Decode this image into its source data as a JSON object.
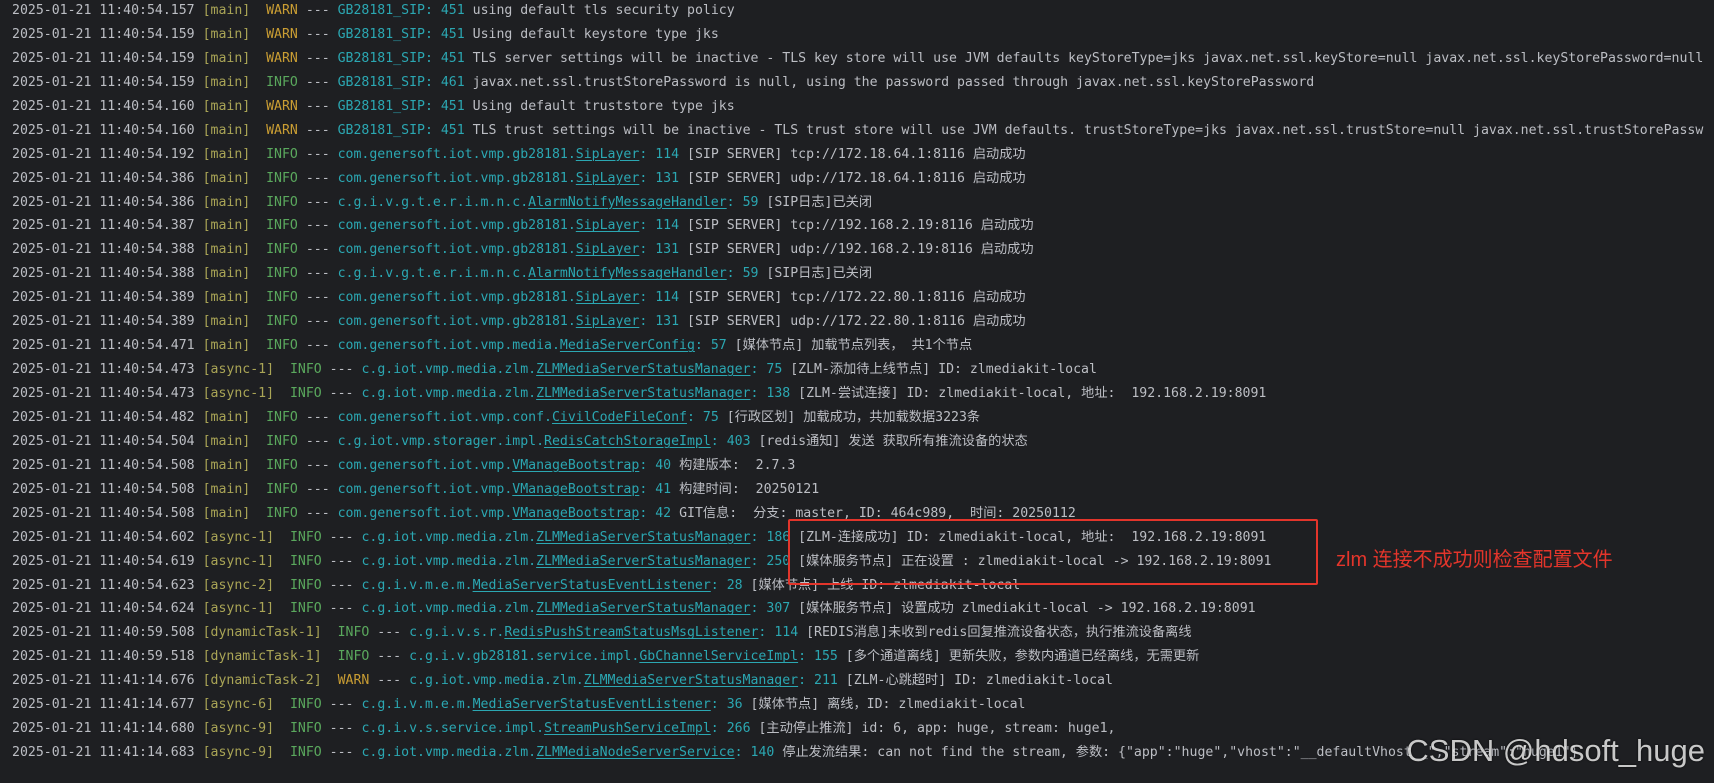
{
  "colors": {
    "background": "#1e1f22",
    "text": "#bcbec4",
    "thread": "#aaa556",
    "warn": "#c99d33",
    "info": "#5aa85d",
    "logger": "#2ba7b2",
    "annotation": "#e3352b",
    "watermark": "#e6e6e6"
  },
  "log": {
    "separator": "---",
    "colon": ":",
    "lines": [
      {
        "time": "2025-01-21 11:40:54.157",
        "thread": "[main]",
        "level": "WARN",
        "logger": "GB28181_SIP",
        "cls": "",
        "line_no": "451",
        "msg": "using default tls security policy"
      },
      {
        "time": "2025-01-21 11:40:54.159",
        "thread": "[main]",
        "level": "WARN",
        "logger": "GB28181_SIP",
        "cls": "",
        "line_no": "451",
        "msg": "Using default keystore type jks"
      },
      {
        "time": "2025-01-21 11:40:54.159",
        "thread": "[main]",
        "level": "WARN",
        "logger": "GB28181_SIP",
        "cls": "",
        "line_no": "451",
        "msg": "TLS server settings will be inactive - TLS key store will use JVM defaults keyStoreType=jks javax.net.ssl.keyStore=null javax.net.ssl.keyStorePassword=null"
      },
      {
        "time": "2025-01-21 11:40:54.159",
        "thread": "[main]",
        "level": "INFO",
        "logger": "GB28181_SIP",
        "cls": "",
        "line_no": "461",
        "msg": "javax.net.ssl.trustStorePassword is null, using the password passed through javax.net.ssl.keyStorePassword"
      },
      {
        "time": "2025-01-21 11:40:54.160",
        "thread": "[main]",
        "level": "WARN",
        "logger": "GB28181_SIP",
        "cls": "",
        "line_no": "451",
        "msg": "Using default truststore type jks"
      },
      {
        "time": "2025-01-21 11:40:54.160",
        "thread": "[main]",
        "level": "WARN",
        "logger": "GB28181_SIP",
        "cls": "",
        "line_no": "451",
        "msg": "TLS trust settings will be inactive - TLS trust store will use JVM defaults. trustStoreType=jks javax.net.ssl.trustStore=null javax.net.ssl.trustStorePassw"
      },
      {
        "time": "2025-01-21 11:40:54.192",
        "thread": "[main]",
        "level": "INFO",
        "logger": "com.genersoft.iot.vmp.gb28181.",
        "cls": "SipLayer",
        "line_no": "114",
        "msg": "[SIP SERVER] tcp://172.18.64.1:8116 启动成功"
      },
      {
        "time": "2025-01-21 11:40:54.386",
        "thread": "[main]",
        "level": "INFO",
        "logger": "com.genersoft.iot.vmp.gb28181.",
        "cls": "SipLayer",
        "line_no": "131",
        "msg": "[SIP SERVER] udp://172.18.64.1:8116 启动成功"
      },
      {
        "time": "2025-01-21 11:40:54.386",
        "thread": "[main]",
        "level": "INFO",
        "logger": "c.g.i.v.g.t.e.r.i.m.n.c.",
        "cls": "AlarmNotifyMessageHandler",
        "line_no": "59",
        "msg": "[SIP日志]已关闭"
      },
      {
        "time": "2025-01-21 11:40:54.387",
        "thread": "[main]",
        "level": "INFO",
        "logger": "com.genersoft.iot.vmp.gb28181.",
        "cls": "SipLayer",
        "line_no": "114",
        "msg": "[SIP SERVER] tcp://192.168.2.19:8116 启动成功"
      },
      {
        "time": "2025-01-21 11:40:54.388",
        "thread": "[main]",
        "level": "INFO",
        "logger": "com.genersoft.iot.vmp.gb28181.",
        "cls": "SipLayer",
        "line_no": "131",
        "msg": "[SIP SERVER] udp://192.168.2.19:8116 启动成功"
      },
      {
        "time": "2025-01-21 11:40:54.388",
        "thread": "[main]",
        "level": "INFO",
        "logger": "c.g.i.v.g.t.e.r.i.m.n.c.",
        "cls": "AlarmNotifyMessageHandler",
        "line_no": "59",
        "msg": "[SIP日志]已关闭"
      },
      {
        "time": "2025-01-21 11:40:54.389",
        "thread": "[main]",
        "level": "INFO",
        "logger": "com.genersoft.iot.vmp.gb28181.",
        "cls": "SipLayer",
        "line_no": "114",
        "msg": "[SIP SERVER] tcp://172.22.80.1:8116 启动成功"
      },
      {
        "time": "2025-01-21 11:40:54.389",
        "thread": "[main]",
        "level": "INFO",
        "logger": "com.genersoft.iot.vmp.gb28181.",
        "cls": "SipLayer",
        "line_no": "131",
        "msg": "[SIP SERVER] udp://172.22.80.1:8116 启动成功"
      },
      {
        "time": "2025-01-21 11:40:54.471",
        "thread": "[main]",
        "level": "INFO",
        "logger": "com.genersoft.iot.vmp.media.",
        "cls": "MediaServerConfig",
        "line_no": "57",
        "msg": "[媒体节点] 加载节点列表， 共1个节点"
      },
      {
        "time": "2025-01-21 11:40:54.473",
        "thread": "[async-1]",
        "level": "INFO",
        "logger": "c.g.iot.vmp.media.zlm.",
        "cls": "ZLMMediaServerStatusManager",
        "line_no": "75",
        "msg": "[ZLM-添加待上线节点] ID: zlmediakit-local"
      },
      {
        "time": "2025-01-21 11:40:54.473",
        "thread": "[async-1]",
        "level": "INFO",
        "logger": "c.g.iot.vmp.media.zlm.",
        "cls": "ZLMMediaServerStatusManager",
        "line_no": "138",
        "msg": "[ZLM-尝试连接] ID: zlmediakit-local, 地址:  192.168.2.19:8091"
      },
      {
        "time": "2025-01-21 11:40:54.482",
        "thread": "[main]",
        "level": "INFO",
        "logger": "com.genersoft.iot.vmp.conf.",
        "cls": "CivilCodeFileConf",
        "line_no": "75",
        "msg": "[行政区划] 加载成功，共加载数据3223条"
      },
      {
        "time": "2025-01-21 11:40:54.504",
        "thread": "[main]",
        "level": "INFO",
        "logger": "c.g.iot.vmp.storager.impl.",
        "cls": "RedisCatchStorageImpl",
        "line_no": "403",
        "msg": "[redis通知] 发送 获取所有推流设备的状态"
      },
      {
        "time": "2025-01-21 11:40:54.508",
        "thread": "[main]",
        "level": "INFO",
        "logger": "com.genersoft.iot.vmp.",
        "cls": "VManageBootstrap",
        "line_no": "40",
        "msg": "构建版本:  2.7.3"
      },
      {
        "time": "2025-01-21 11:40:54.508",
        "thread": "[main]",
        "level": "INFO",
        "logger": "com.genersoft.iot.vmp.",
        "cls": "VManageBootstrap",
        "line_no": "41",
        "msg": "构建时间:  20250121"
      },
      {
        "time": "2025-01-21 11:40:54.508",
        "thread": "[main]",
        "level": "INFO",
        "logger": "com.genersoft.iot.vmp.",
        "cls": "VManageBootstrap",
        "line_no": "42",
        "msg": "GIT信息:  分支: master, ID: 464c989,  时间: 20250112"
      },
      {
        "time": "2025-01-21 11:40:54.602",
        "thread": "[async-1]",
        "level": "INFO",
        "logger": "c.g.iot.vmp.media.zlm.",
        "cls": "ZLMMediaServerStatusManager",
        "line_no": "186",
        "msg": "[ZLM-连接成功] ID: zlmediakit-local, 地址:  192.168.2.19:8091"
      },
      {
        "time": "2025-01-21 11:40:54.619",
        "thread": "[async-1]",
        "level": "INFO",
        "logger": "c.g.iot.vmp.media.zlm.",
        "cls": "ZLMMediaServerStatusManager",
        "line_no": "250",
        "msg": "[媒体服务节点] 正在设置 : zlmediakit-local -> 192.168.2.19:8091"
      },
      {
        "time": "2025-01-21 11:40:54.623",
        "thread": "[async-2]",
        "level": "INFO",
        "logger": "c.g.i.v.m.e.m.",
        "cls": "MediaServerStatusEventListener",
        "line_no": "28",
        "msg": "[媒体节点] 上线 ID: zlmediakit-local"
      },
      {
        "time": "2025-01-21 11:40:54.624",
        "thread": "[async-1]",
        "level": "INFO",
        "logger": "c.g.iot.vmp.media.zlm.",
        "cls": "ZLMMediaServerStatusManager",
        "line_no": "307",
        "msg": "[媒体服务节点] 设置成功 zlmediakit-local -> 192.168.2.19:8091"
      },
      {
        "time": "2025-01-21 11:40:59.508",
        "thread": "[dynamicTask-1]",
        "level": "INFO",
        "logger": "c.g.i.v.s.r.",
        "cls": "RedisPushStreamStatusMsgListener",
        "line_no": "114",
        "msg": "[REDIS消息]未收到redis回复推流设备状态，执行推流设备离线"
      },
      {
        "time": "2025-01-21 11:40:59.518",
        "thread": "[dynamicTask-1]",
        "level": "INFO",
        "logger": "c.g.i.v.gb28181.service.impl.",
        "cls": "GbChannelServiceImpl",
        "line_no": "155",
        "msg": "[多个通道离线] 更新失败，参数内通道已经离线，无需更新"
      },
      {
        "time": "2025-01-21 11:41:14.676",
        "thread": "[dynamicTask-2]",
        "level": "WARN",
        "logger": "c.g.iot.vmp.media.zlm.",
        "cls": "ZLMMediaServerStatusManager",
        "line_no": "211",
        "msg": "[ZLM-心跳超时] ID: zlmediakit-local"
      },
      {
        "time": "2025-01-21 11:41:14.677",
        "thread": "[async-6]",
        "level": "INFO",
        "logger": "c.g.i.v.m.e.m.",
        "cls": "MediaServerStatusEventListener",
        "line_no": "36",
        "msg": "[媒体节点] 离线，ID: zlmediakit-local"
      },
      {
        "time": "2025-01-21 11:41:14.680",
        "thread": "[async-9]",
        "level": "INFO",
        "logger": "c.g.i.v.s.service.impl.",
        "cls": "StreamPushServiceImpl",
        "line_no": "266",
        "msg": "[主动停止推流] id: 6, app: huge, stream: huge1,"
      },
      {
        "time": "2025-01-21 11:41:14.683",
        "thread": "[async-9]",
        "level": "INFO",
        "logger": "c.g.iot.vmp.media.zlm.",
        "cls": "ZLMMediaNodeServerService",
        "line_no": "140",
        "msg": "停止发流结果: can not find the stream, 参数: {\"app\":\"huge\",\"vhost\":\"__defaultVhost__\",\"stream\":\"huge1\"}"
      }
    ]
  },
  "annotation": {
    "label": "zlm 连接不成功则检查配置文件"
  },
  "watermark": {
    "text": "CSDN @hdsoft_huge"
  }
}
